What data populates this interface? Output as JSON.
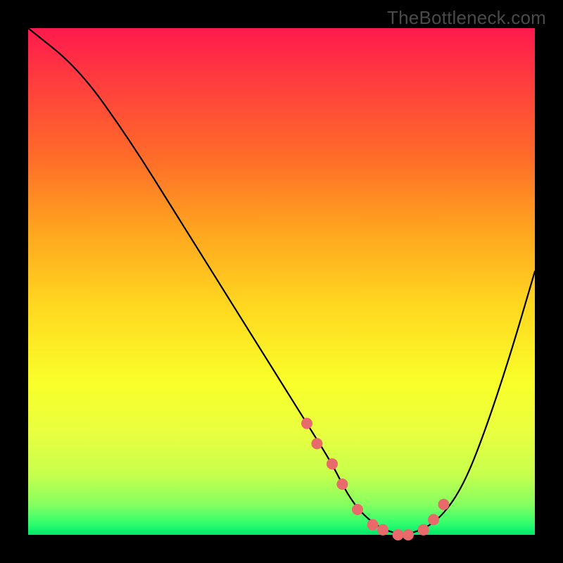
{
  "watermark": "TheBottleneck.com",
  "chart_data": {
    "type": "line",
    "title": "",
    "xlabel": "",
    "ylabel": "",
    "xlim": [
      0,
      100
    ],
    "ylim": [
      0,
      100
    ],
    "series": [
      {
        "name": "bottleneck-curve",
        "x": [
          0,
          10,
          20,
          30,
          40,
          50,
          55,
          60,
          63,
          66,
          70,
          74,
          78,
          82,
          86,
          90,
          95,
          100
        ],
        "y": [
          100,
          92,
          78,
          62,
          46,
          30,
          22,
          14,
          8,
          4,
          1,
          0,
          1,
          4,
          10,
          20,
          35,
          52
        ]
      }
    ],
    "markers": {
      "name": "highlight-dots",
      "x": [
        55,
        57,
        60,
        62,
        65,
        68,
        70,
        73,
        75,
        78,
        80,
        82
      ],
      "y": [
        22,
        18,
        14,
        10,
        5,
        2,
        1,
        0,
        0,
        1,
        3,
        6
      ]
    }
  }
}
